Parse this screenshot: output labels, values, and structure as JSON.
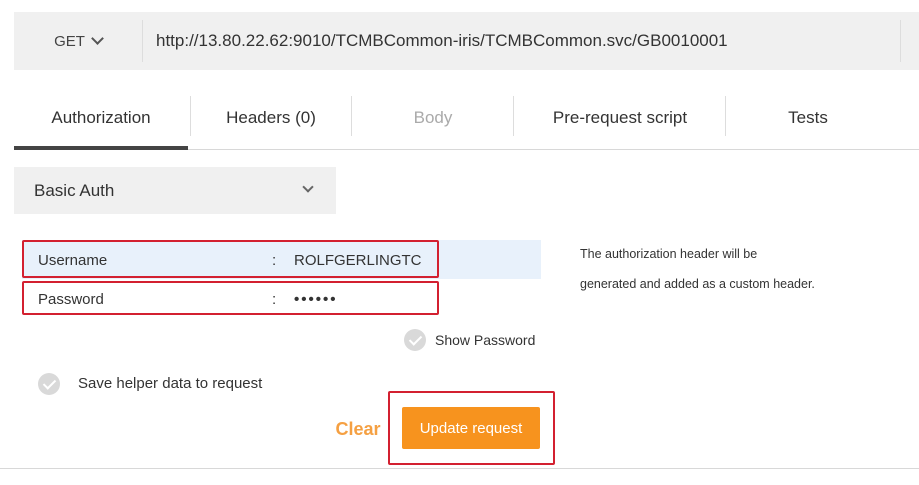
{
  "request": {
    "method": "GET",
    "url": "http://13.80.22.62:9010/TCMBCommon-iris/TCMBCommon.svc/GB0010001"
  },
  "tabs": [
    {
      "label": "Authorization",
      "active": true
    },
    {
      "label": "Headers (0)"
    },
    {
      "label": "Body",
      "disabled": true
    },
    {
      "label": "Pre-request script"
    },
    {
      "label": "Tests"
    }
  ],
  "auth": {
    "type": "Basic Auth",
    "username_label": "Username",
    "username_value": "ROLFGERLINGTC",
    "password_label": "Password",
    "password_value": "••••••",
    "colon": ":",
    "show_password_label": "Show Password",
    "save_helper_label": "Save helper data to request",
    "help_line1": "The authorization header will be",
    "help_line2": "generated and added as a custom header.",
    "clear_label": "Clear",
    "update_label": "Update request"
  },
  "colors": {
    "accent": "#f7931e",
    "highlight": "#d32030"
  }
}
